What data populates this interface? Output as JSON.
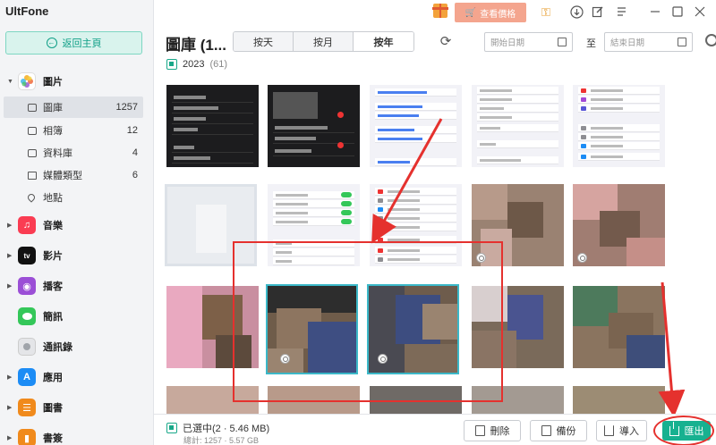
{
  "app": {
    "name": "UltFone"
  },
  "sidebar": {
    "home_label": "返回主頁",
    "categories": [
      {
        "label": "圖片",
        "icon": "photos-app-icon",
        "color": "#f0a030"
      },
      {
        "label": "音樂",
        "icon": "music-app-icon",
        "color": "#fa3c52"
      },
      {
        "label": "影片",
        "icon": "apple-tv-app-icon",
        "color": "#111111"
      },
      {
        "label": "播客",
        "icon": "podcasts-app-icon",
        "color": "#9b4fd6"
      },
      {
        "label": "簡訊",
        "icon": "messages-app-icon",
        "color": "#34c759"
      },
      {
        "label": "通訊錄",
        "icon": "contacts-app-icon",
        "color": "#a0a4aa"
      },
      {
        "label": "應用",
        "icon": "app-store-icon",
        "color": "#1c8cf5"
      },
      {
        "label": "圖書",
        "icon": "books-app-icon",
        "color": "#f08a1c"
      },
      {
        "label": "書簽",
        "icon": "bookmarks-app-icon",
        "color": "#f08a1c"
      }
    ],
    "photo_subitems": [
      {
        "label": "圖庫",
        "count": "1257",
        "icon": "gallery-icon"
      },
      {
        "label": "相簿",
        "count": "12",
        "icon": "album-icon"
      },
      {
        "label": "資料庫",
        "count": "4",
        "icon": "library-icon"
      },
      {
        "label": "媒體類型",
        "count": "6",
        "icon": "media-type-icon"
      },
      {
        "label": "地點",
        "count": "",
        "icon": "location-icon"
      }
    ]
  },
  "topbar": {
    "price_label": "查看價格",
    "icons": [
      "gift-icon",
      "key-icon",
      "download-icon",
      "edit-icon",
      "menu-icon",
      "minimize-icon",
      "maximize-icon",
      "close-icon"
    ]
  },
  "toolbar": {
    "title": "圖庫 (1...",
    "tabs": [
      "按天",
      "按月",
      "按年"
    ],
    "active_tab": "按年",
    "start_date_placeholder": "開始日期",
    "separator": "至",
    "end_date_placeholder": "結束日期"
  },
  "content": {
    "year": "2023",
    "year_count": "(61)"
  },
  "bottom": {
    "selected_text": "已選中(2 · 5.46 MB)",
    "total_text": "總計: 1257 · 5.57 GB",
    "delete_label": "刪除",
    "backup_label": "備份",
    "import_label": "導入",
    "export_label": "匯出"
  },
  "colors": {
    "accent": "#17b190",
    "annotation": "#e5312e",
    "selection": "#3bb8c8"
  }
}
